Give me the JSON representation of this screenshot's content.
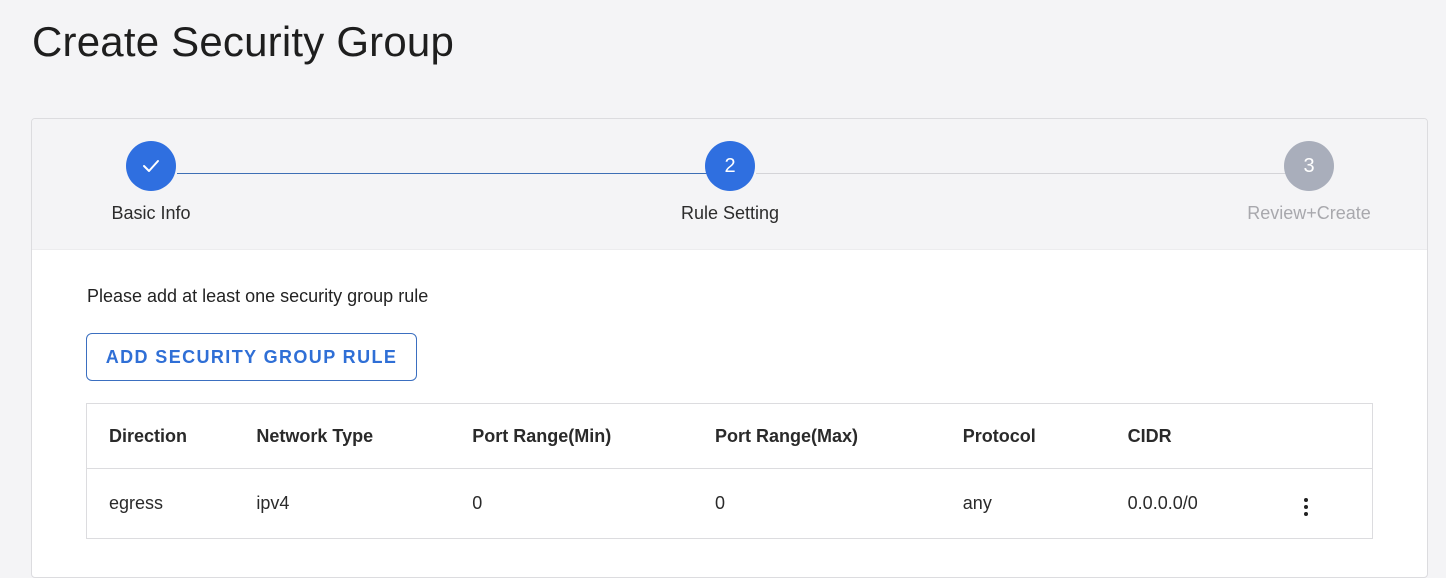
{
  "page": {
    "title": "Create Security Group"
  },
  "stepper": {
    "steps": [
      {
        "number": "1",
        "label": "Basic Info",
        "state": "completed"
      },
      {
        "number": "2",
        "label": "Rule Setting",
        "state": "active"
      },
      {
        "number": "3",
        "label": "Review+Create",
        "state": "inactive"
      }
    ]
  },
  "content": {
    "instruction": "Please add at least one security group rule",
    "add_button_label": "ADD SECURITY GROUP RULE"
  },
  "table": {
    "columns": [
      "Direction",
      "Network Type",
      "Port Range(Min)",
      "Port Range(Max)",
      "Protocol",
      "CIDR"
    ],
    "rows": [
      [
        "egress",
        "ipv4",
        "0",
        "0",
        "any",
        "0.0.0.0/0"
      ]
    ]
  },
  "colors": {
    "accent": "#2f6fe0",
    "inactive_step": "#a9aebb",
    "background": "#f4f4f6"
  },
  "icons": {
    "completed_step": "check-icon",
    "row_menu": "more-vertical-icon"
  }
}
